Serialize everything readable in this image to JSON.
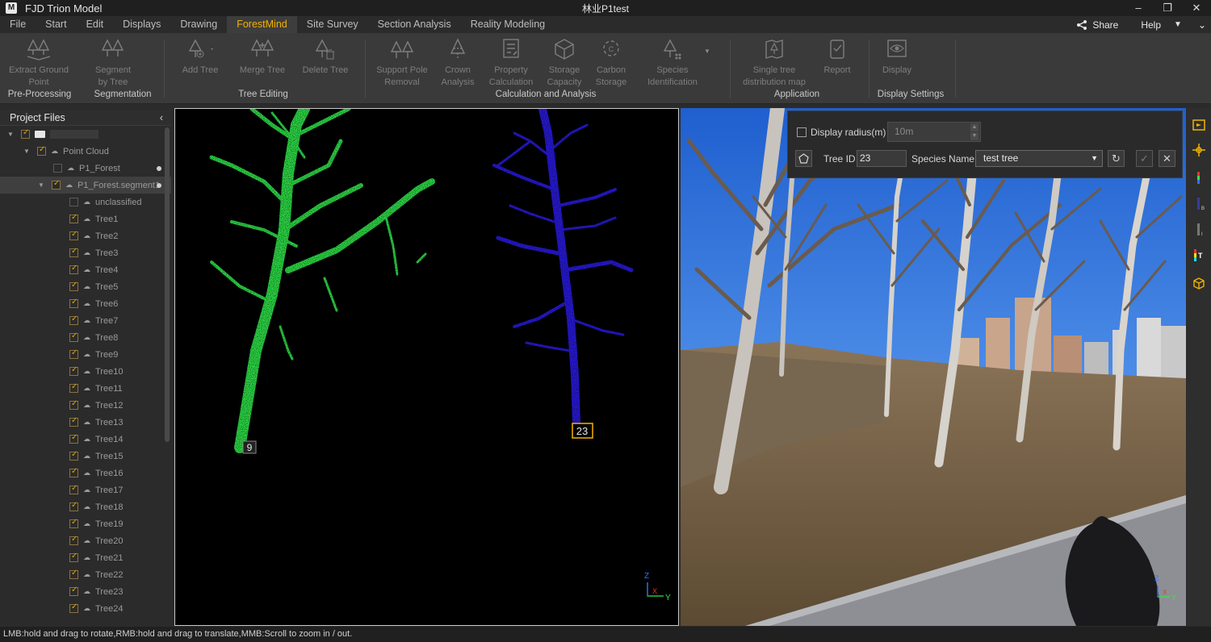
{
  "app": {
    "title": "FJD Trion Model",
    "logo": "M",
    "document_title": "林业P1test"
  },
  "window_controls": {
    "minimize": "–",
    "restore": "❐",
    "close": "✕"
  },
  "menu": {
    "items": [
      "File",
      "Start",
      "Edit",
      "Displays",
      "Drawing",
      "ForestMind",
      "Site Survey",
      "Section Analysis",
      "Reality Modeling"
    ],
    "active": "ForestMind",
    "share_label": "Share",
    "help_label": "Help"
  },
  "ribbon": {
    "buttons": {
      "extract_ground_point": "Extract Ground\nPoint",
      "segment_by_tree": "Segment\nby Tree",
      "add_tree": "Add Tree",
      "merge_tree": "Merge Tree",
      "delete_tree": "Delete Tree",
      "support_pole_removal": "Support Pole\nRemoval",
      "crown_analysis": "Crown\nAnalysis",
      "property_calculation": "Property\nCalculation",
      "storage_capacity": "Storage\nCapacity",
      "carbon_storage": "Carbon\nStorage",
      "species_identification": "Species\nIdentification",
      "single_tree_distribution_map": "Single tree\ndistribution map",
      "report": "Report",
      "display": "Display"
    },
    "groups": {
      "pre_processing": "Pre-Processing",
      "segmentation": "Segmentation",
      "tree_editing": "Tree Editing",
      "calculation_and_analysis": "Calculation and Analysis",
      "application": "Application",
      "display_settings": "Display Settings"
    }
  },
  "project_files": {
    "title": "Project Files",
    "point_cloud_label": "Point Cloud",
    "items": [
      "P1_Forest",
      "P1_Forest.segment1",
      "unclassified",
      "Tree1",
      "Tree2",
      "Tree3",
      "Tree4",
      "Tree5",
      "Tree6",
      "Tree7",
      "Tree8",
      "Tree9",
      "Tree10",
      "Tree11",
      "Tree12",
      "Tree13",
      "Tree14",
      "Tree15",
      "Tree16",
      "Tree17",
      "Tree18",
      "Tree19",
      "Tree20",
      "Tree21",
      "Tree22",
      "Tree23",
      "Tree24"
    ]
  },
  "viewport_left": {
    "tree_labels": [
      "9",
      "23"
    ],
    "axis": {
      "z": "Z",
      "x": "X",
      "y": "Y"
    }
  },
  "panorama_panel": {
    "display_radius_label": "Display radius(m)",
    "display_radius_value": "10m",
    "tree_id_label": "Tree ID",
    "tree_id_value": "23",
    "species_name_label": "Species Name",
    "species_name_value": "test tree"
  },
  "status_bar": {
    "hint": "LMB:hold and drag to rotate,RMB:hold and drag to translate,MMB:Scroll to zoom in / out."
  },
  "colors": {
    "accent": "#f2b200",
    "green_tree": "#2fe84a",
    "blue_tree": "#2a1ae8"
  }
}
